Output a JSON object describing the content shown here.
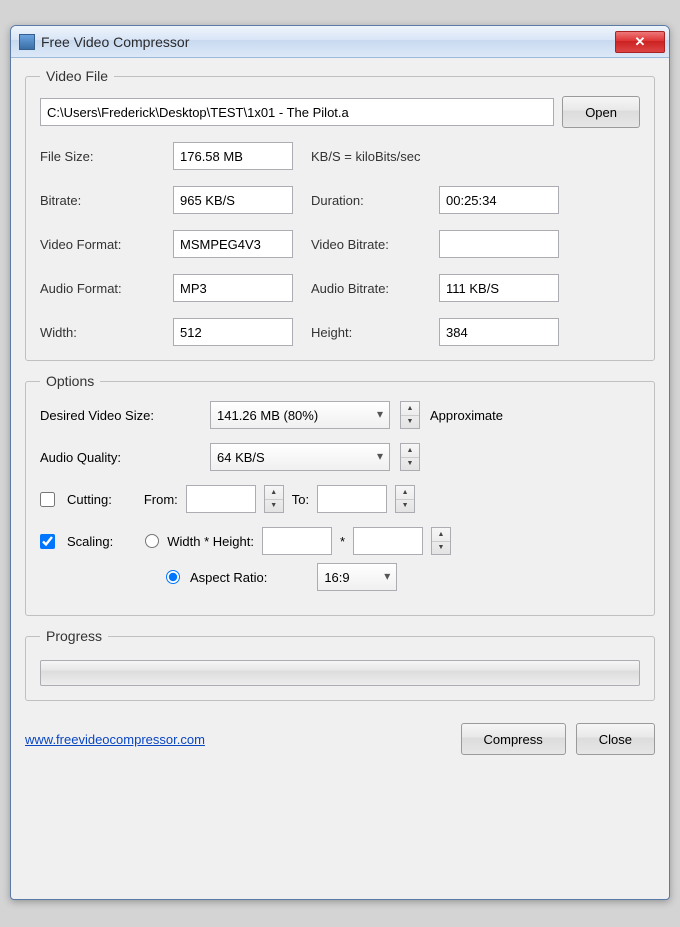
{
  "window": {
    "title": "Free Video Compressor"
  },
  "videoFile": {
    "legend": "Video File",
    "path": "C:\\Users\\Frederick\\Desktop\\TEST\\1x01 - The Pilot.a",
    "openLabel": "Open",
    "noteKbps": "KB/S = kiloBits/sec",
    "labels": {
      "fileSize": "File Size:",
      "bitrate": "Bitrate:",
      "videoFormat": "Video Format:",
      "audioFormat": "Audio Format:",
      "width": "Width:",
      "duration": "Duration:",
      "videoBitrate": "Video Bitrate:",
      "audioBitrate": "Audio Bitrate:",
      "height": "Height:"
    },
    "values": {
      "fileSize": "176.58 MB",
      "bitrate": "965 KB/S",
      "videoFormat": "MSMPEG4V3",
      "audioFormat": "MP3",
      "width": "512",
      "duration": "00:25:34",
      "videoBitrate": "",
      "audioBitrate": "111 KB/S",
      "height": "384"
    }
  },
  "options": {
    "legend": "Options",
    "labels": {
      "desiredSize": "Desired Video Size:",
      "audioQuality": "Audio Quality:",
      "approximate": "Approximate",
      "cutting": "Cutting:",
      "from": "From:",
      "to": "To:",
      "scaling": "Scaling:",
      "widthHeight": "Width * Height:",
      "aspectRatio": "Aspect Ratio:",
      "times": "*"
    },
    "values": {
      "desiredSize": "141.26 MB (80%)",
      "audioQuality": "64 KB/S",
      "cuttingChecked": false,
      "cuttingFrom": "",
      "cuttingTo": "",
      "scalingChecked": true,
      "scalingMode": "aspect",
      "scaleWidth": "",
      "scaleHeight": "",
      "aspectRatio": "16:9"
    }
  },
  "progress": {
    "legend": "Progress"
  },
  "footer": {
    "link": "www.freevideocompressor.com",
    "compressLabel": "Compress",
    "closeLabel": "Close"
  }
}
